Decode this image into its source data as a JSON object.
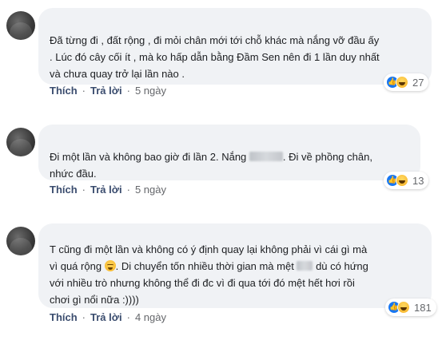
{
  "comments": [
    {
      "lines": [
        "Đã từng đi , đất rộng , đi mỏi chân mới tới chỗ khác mà nắng vỡ đầu ấy",
        ". Lúc đó cây cối ít , mà ko hấp dẫn bằng Đầm Sen nên đi 1 lần duy nhất",
        "và chưa quay trở lại lần nào ."
      ],
      "reaction_count": "27",
      "like_label": "Thích",
      "reply_label": "Trả lời",
      "time": "5 ngày"
    },
    {
      "line1_before": "Đi một lần và không bao giờ đi lần 2. Nắng",
      "line1_after": ". Đi về phồng chân,",
      "line2": "nhức đầu.",
      "reaction_count": "13",
      "like_label": "Thích",
      "reply_label": "Trả lời",
      "time": "5 ngày"
    },
    {
      "line1": "T cũng đi một lần và không có ý định quay lại không phải vì cái gì mà",
      "line2_before": "vì quá rộng",
      "line2_after": ". Di chuyển tốn nhiều thời gian mà mệt",
      "line2_end": "dù có hứng",
      "line3": "với nhiều trò nhưng không thể đi đc vì đi qua tới đó mệt hết hơi rồi",
      "line4": "chơi gì nổi nữa :))))",
      "reaction_count": "181",
      "like_label": "Thích",
      "reply_label": "Trả lời",
      "time": "4 ngày"
    }
  ],
  "separator": "·"
}
